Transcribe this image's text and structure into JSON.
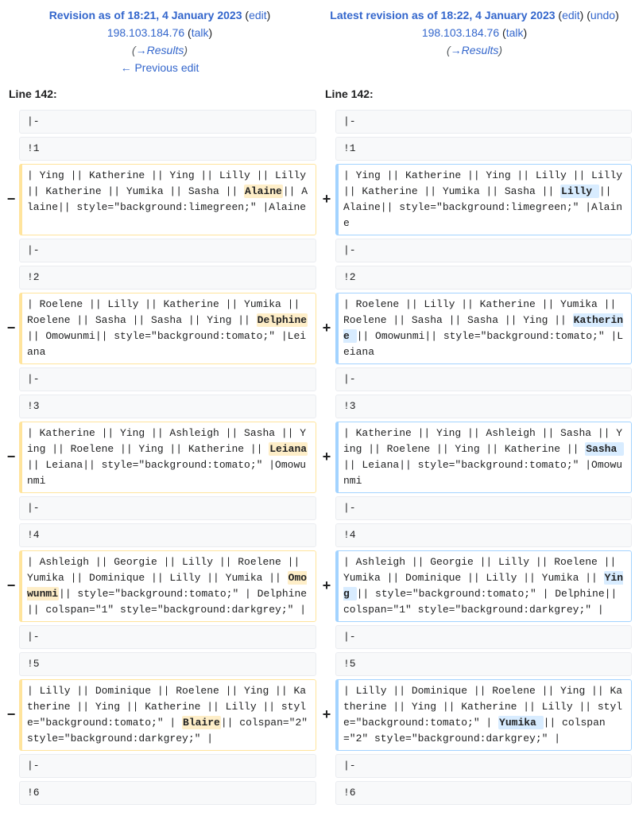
{
  "header": {
    "left": {
      "title": "Revision as of 18:21, 4 January 2023",
      "edit": "edit",
      "user": "198.103.184.76",
      "talk": "talk",
      "section": "→Results",
      "prev": "← Previous edit"
    },
    "right": {
      "title": "Latest revision as of 18:22, 4 January 2023",
      "edit": "edit",
      "undo": "undo",
      "user": "198.103.184.76",
      "talk": "talk",
      "section": "→Results"
    }
  },
  "line_left": "Line 142:",
  "line_right": "Line 142:",
  "markers": {
    "del": "−",
    "add": "+"
  },
  "rows": [
    {
      "type": "ctx",
      "text": "|-"
    },
    {
      "type": "ctx",
      "text": "!1"
    },
    {
      "type": "chg",
      "l_pre": "| Ying || Katherine || Ying || Lilly || Lilly || Katherine || Yumika || Sasha || ",
      "l_hl": "Alaine",
      "l_post": "|| Alaine|| style=\"background:limegreen;\" |Alaine",
      "r_pre": "| Ying || Katherine || Ying || Lilly || Lilly || Katherine || Yumika || Sasha || ",
      "r_hl": "Lilly ",
      "r_post": "|| Alaine|| style=\"background:limegreen;\" |Alaine"
    },
    {
      "type": "ctx",
      "text": "|-"
    },
    {
      "type": "ctx",
      "text": "!2"
    },
    {
      "type": "chg",
      "l_pre": "| Roelene || Lilly || Katherine || Yumika || Roelene || Sasha || Sasha || Ying || ",
      "l_hl": "Delphine",
      "l_post": "|| Omowunmi|| style=\"background:tomato;\" |Leiana",
      "r_pre": "| Roelene || Lilly || Katherine || Yumika || Roelene || Sasha || Sasha || Ying || ",
      "r_hl": "Katherine ",
      "r_post": "|| Omowunmi|| style=\"background:tomato;\" |Leiana"
    },
    {
      "type": "ctx",
      "text": "|-"
    },
    {
      "type": "ctx",
      "text": "!3"
    },
    {
      "type": "chg",
      "l_pre": "| Katherine || Ying || Ashleigh || Sasha || Ying || Roelene || Ying || Katherine || ",
      "l_hl": "Leiana",
      "l_post": "|| Leiana|| style=\"background:tomato;\" |Omowunmi",
      "r_pre": "| Katherine || Ying || Ashleigh || Sasha || Ying || Roelene || Ying || Katherine || ",
      "r_hl": "Sasha ",
      "r_post": "|| Leiana|| style=\"background:tomato;\" |Omowunmi"
    },
    {
      "type": "ctx",
      "text": "|-"
    },
    {
      "type": "ctx",
      "text": "!4"
    },
    {
      "type": "chg",
      "l_pre": "| Ashleigh || Georgie || Lilly || Roelene || Yumika || Dominique || Lilly || Yumika || ",
      "l_hl": "Omowunmi",
      "l_post": "|| style=\"background:tomato;\" | Delphine|| colspan=\"1\" style=\"background:darkgrey;\" |",
      "r_pre": "| Ashleigh || Georgie || Lilly || Roelene || Yumika || Dominique || Lilly || Yumika || ",
      "r_hl": "Ying ",
      "r_post": "|| style=\"background:tomato;\" | Delphine|| colspan=\"1\" style=\"background:darkgrey;\" |"
    },
    {
      "type": "ctx",
      "text": "|-"
    },
    {
      "type": "ctx",
      "text": "!5"
    },
    {
      "type": "chg",
      "l_pre": "| Lilly || Dominique || Roelene || Ying || Katherine || Ying || Katherine || Lilly || style=\"background:tomato;\" | ",
      "l_hl": "Blaire",
      "l_post": "|| colspan=\"2\" style=\"background:darkgrey;\" |",
      "r_pre": "| Lilly || Dominique || Roelene || Ying || Katherine || Ying || Katherine || Lilly || style=\"background:tomato;\" | ",
      "r_hl": "Yumika ",
      "r_post": "|| colspan=\"2\" style=\"background:darkgrey;\" |"
    },
    {
      "type": "ctx",
      "text": "|-"
    },
    {
      "type": "ctx",
      "text": "!6"
    }
  ]
}
